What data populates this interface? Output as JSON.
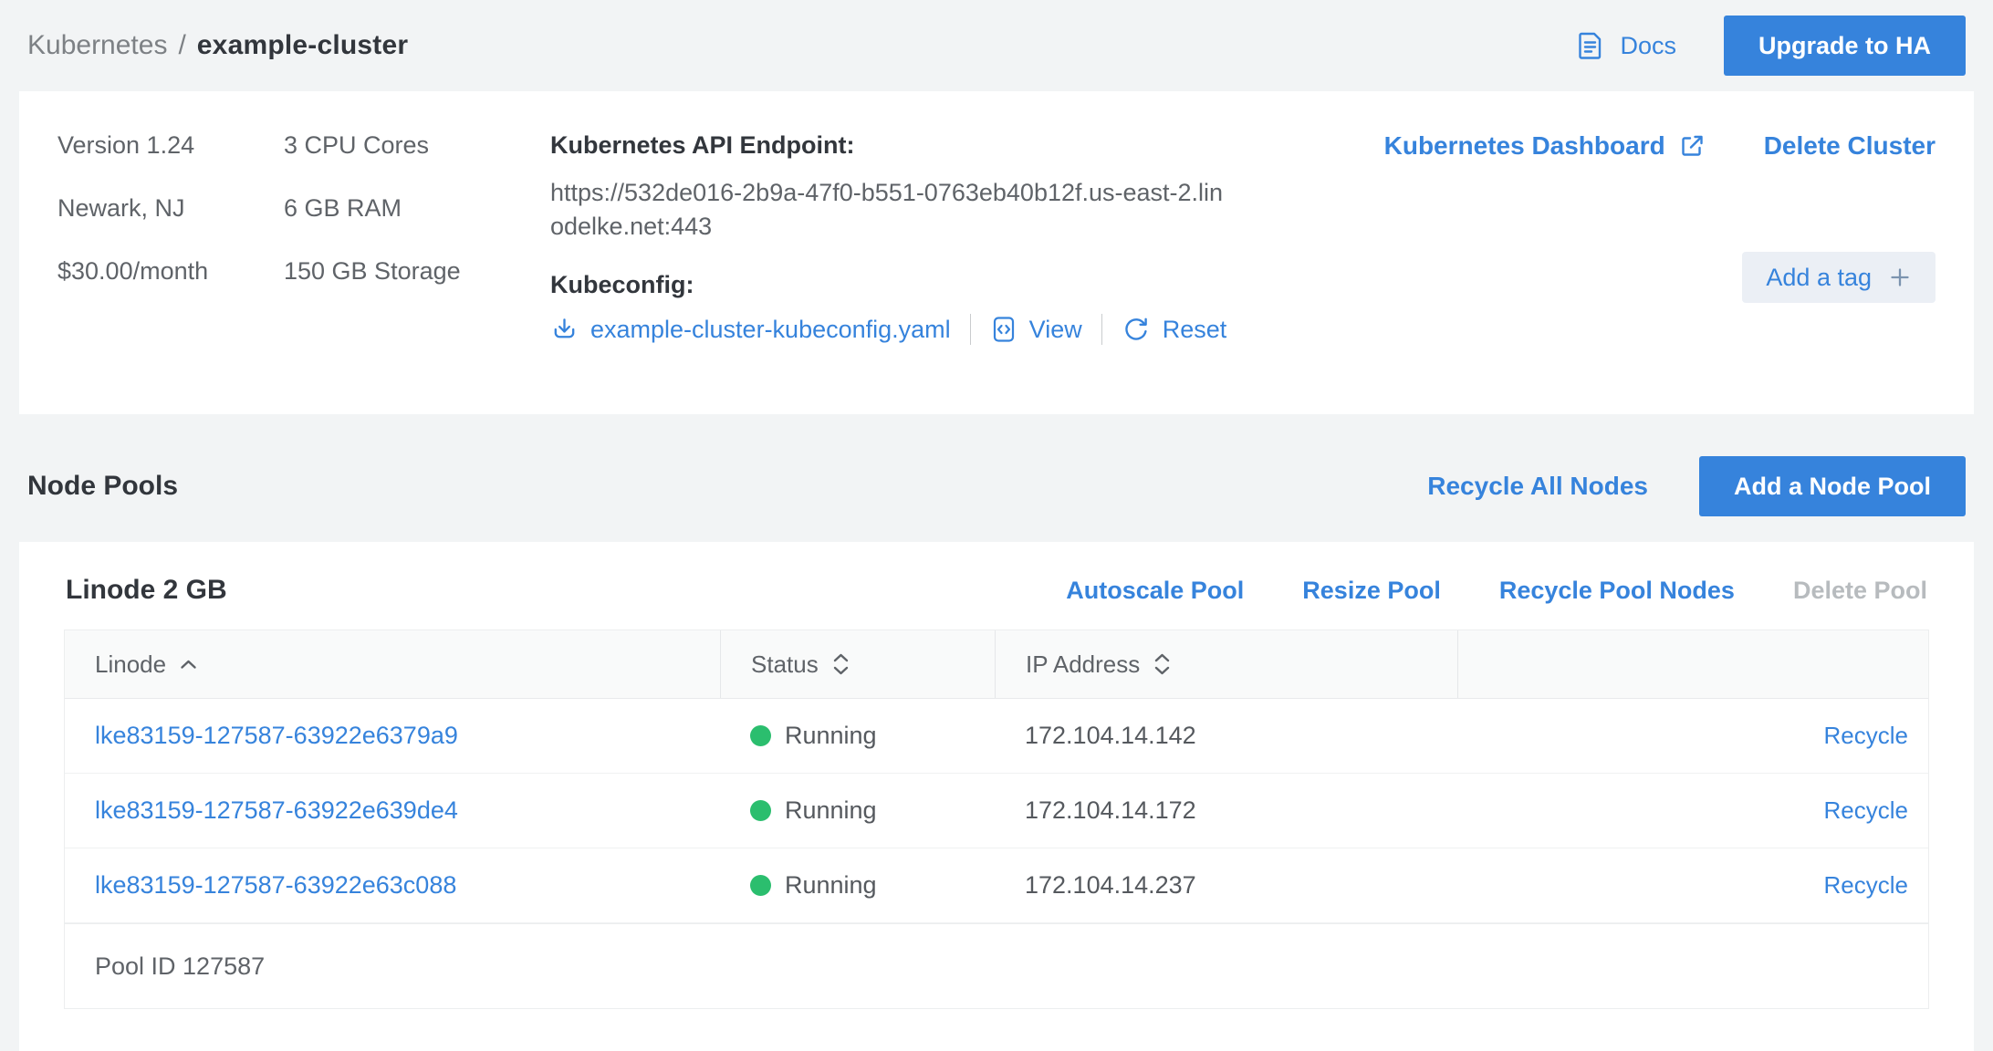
{
  "breadcrumb": {
    "section": "Kubernetes",
    "separator": "/",
    "current": "example-cluster"
  },
  "header": {
    "docs_label": "Docs",
    "upgrade_button": "Upgrade to HA"
  },
  "summary": {
    "column1": [
      "Version 1.24",
      "Newark, NJ",
      "$30.00/month"
    ],
    "column2": [
      "3 CPU Cores",
      "6 GB RAM",
      "150 GB Storage"
    ],
    "api_endpoint_label": "Kubernetes API Endpoint:",
    "api_endpoint_url": "https://532de016-2b9a-47f0-b551-0763eb40b12f.us-east-2.linodelke.net:443",
    "kubeconfig_label": "Kubeconfig:",
    "kubeconfig_file": "example-cluster-kubeconfig.yaml",
    "view_label": "View",
    "reset_label": "Reset",
    "dashboard_link": "Kubernetes Dashboard",
    "delete_cluster_link": "Delete Cluster",
    "add_tag_label": "Add a tag"
  },
  "node_pools": {
    "title": "Node Pools",
    "recycle_all_label": "Recycle All Nodes",
    "add_pool_button": "Add a Node Pool"
  },
  "pool": {
    "name": "Linode 2 GB",
    "actions": [
      "Autoscale Pool",
      "Resize Pool",
      "Recycle Pool Nodes"
    ],
    "disabled_action": "Delete Pool",
    "table": {
      "columns": [
        "Linode",
        "Status",
        "IP Address"
      ],
      "rows": [
        {
          "linode": "lke83159-127587-63922e6379a9",
          "status": "Running",
          "ip": "172.104.14.142",
          "action": "Recycle"
        },
        {
          "linode": "lke83159-127587-63922e639de4",
          "status": "Running",
          "ip": "172.104.14.172",
          "action": "Recycle"
        },
        {
          "linode": "lke83159-127587-63922e63c088",
          "status": "Running",
          "ip": "172.104.14.237",
          "action": "Recycle"
        }
      ],
      "footer": "Pool ID 127587"
    }
  },
  "icons": {
    "docs": "document-lines-icon",
    "external_link": "arrow-up-right-box-icon",
    "download": "arrow-down-tray-icon",
    "view": "code-brackets-icon",
    "reset": "circular-arrow-icon",
    "add": "plus-icon",
    "sort_asc": "chevron-up-icon",
    "sort_both": "chevron-up-down-icon",
    "status": "filled-circle-dot"
  },
  "colors": {
    "accent_blue": "#3683dc",
    "status_green": "#2bbe6e",
    "disabled_gray": "#b7bbbe",
    "page_background": "#f2f4f5"
  }
}
